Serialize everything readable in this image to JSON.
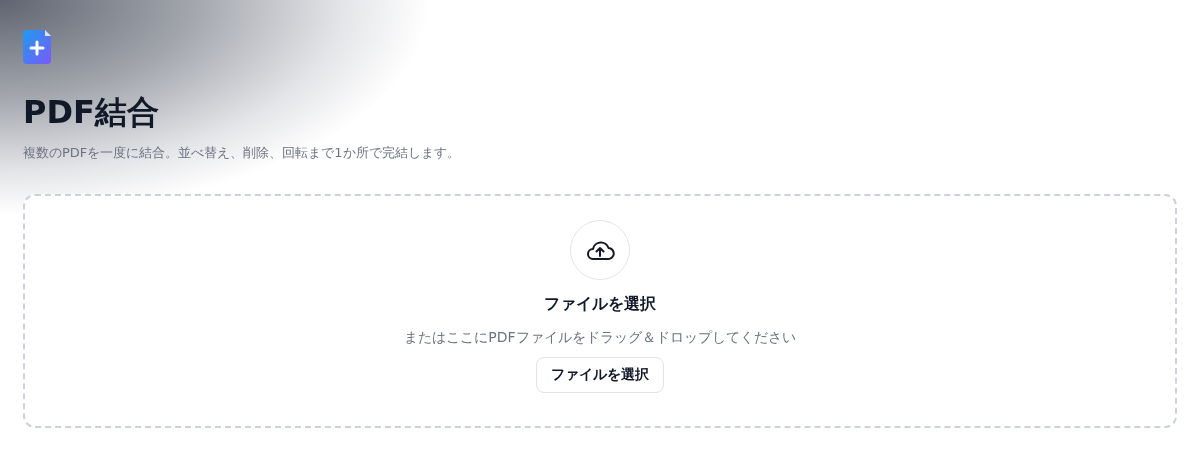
{
  "header": {
    "title": "PDF結合",
    "subtitle": "複数のPDFを一度に結合。並べ替え、削除、回転まで1か所で完結します。"
  },
  "dropzone": {
    "heading": "ファイルを選択",
    "hint": "またはここにPDFファイルをドラッグ＆ドロップしてください",
    "button": "ファイルを選択"
  }
}
